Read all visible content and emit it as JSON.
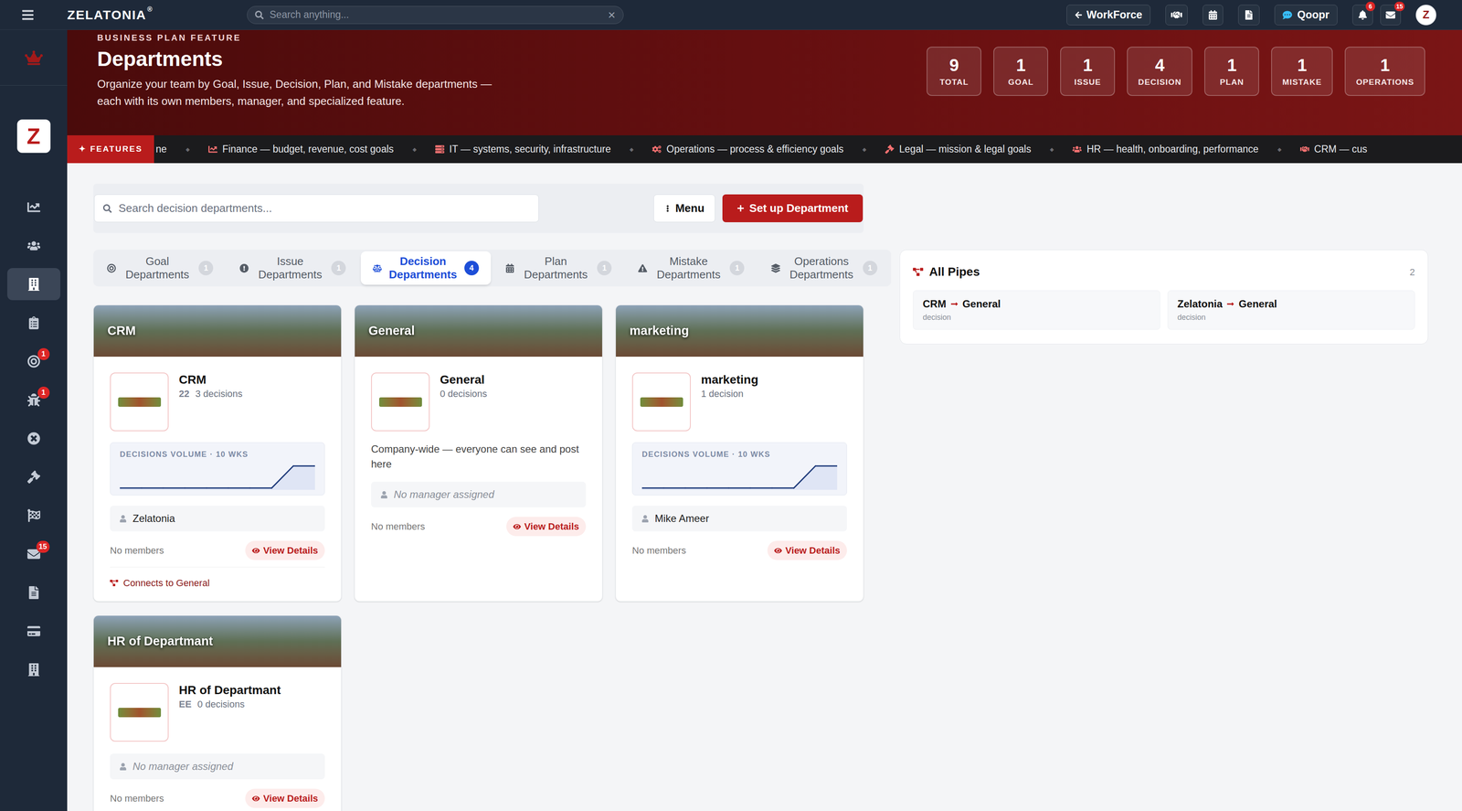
{
  "topbar": {
    "logo": "ZELATONIA",
    "logo_mark": "®",
    "search": {
      "placeholder": "Search anything...",
      "clear": "×"
    },
    "workforce": "WorkForce",
    "qoopr": "Qoopr",
    "notifications_badge": "6",
    "messages_badge": "15",
    "avatar": "Z"
  },
  "sidebar": {
    "brand": "Z",
    "items": [
      {
        "kind": "analytics",
        "selected": false,
        "badge": null
      },
      {
        "kind": "people",
        "selected": false,
        "badge": null
      },
      {
        "kind": "departments",
        "selected": true,
        "badge": null
      },
      {
        "kind": "tasks",
        "selected": false,
        "badge": null
      },
      {
        "kind": "goals",
        "selected": false,
        "badge": "1"
      },
      {
        "kind": "issues",
        "selected": false,
        "badge": "1"
      },
      {
        "kind": "mistakes",
        "selected": false,
        "badge": null
      },
      {
        "kind": "decisions",
        "selected": false,
        "badge": null
      },
      {
        "kind": "milestones",
        "selected": false,
        "badge": null
      },
      {
        "kind": "messages",
        "selected": false,
        "badge": "15"
      },
      {
        "kind": "documents",
        "selected": false,
        "badge": null
      },
      {
        "kind": "billing",
        "selected": false,
        "badge": null
      },
      {
        "kind": "company",
        "selected": false,
        "badge": null
      }
    ]
  },
  "header": {
    "eyebrow": "BUSINESS PLAN FEATURE",
    "title": "Departments",
    "description": "Organize your team by Goal, Issue, Decision, Plan, and Mistake departments — each with its own members, manager, and specialized feature.",
    "stats": [
      {
        "value": "9",
        "label": "TOTAL"
      },
      {
        "value": "1",
        "label": "GOAL"
      },
      {
        "value": "1",
        "label": "ISSUE"
      },
      {
        "value": "4",
        "label": "DECISION"
      },
      {
        "value": "1",
        "label": "PLAN"
      },
      {
        "value": "1",
        "label": "MISTAKE"
      },
      {
        "value": "1",
        "label": "OPERATIONS"
      }
    ]
  },
  "features": {
    "icon": "✦",
    "label": "FEATURES",
    "separator": "◆",
    "items": [
      {
        "kind": "none",
        "text": "ne"
      },
      {
        "kind": "finance",
        "text": "Finance — budget, revenue, cost goals"
      },
      {
        "kind": "it",
        "text": "IT — systems, security, infrastructure"
      },
      {
        "kind": "operations",
        "text": "Operations — process & efficiency goals"
      },
      {
        "kind": "legal",
        "text": "Legal — mission & legal goals"
      },
      {
        "kind": "hr",
        "text": "HR — health, onboarding, performance"
      },
      {
        "kind": "crm",
        "text": "CRM — cus"
      }
    ]
  },
  "toolbar": {
    "search_placeholder": "Search decision departments...",
    "menu": "Menu",
    "setup": "Set up Department"
  },
  "tabs": [
    {
      "kind": "goal",
      "label": "Goal Departments",
      "count": "1",
      "selected": false
    },
    {
      "kind": "issue",
      "label": "Issue Departments",
      "count": "1",
      "selected": false
    },
    {
      "kind": "decision",
      "label": "Decision Departments",
      "count": "4",
      "selected": true
    },
    {
      "kind": "plan",
      "label": "Plan Departments",
      "count": "1",
      "selected": false
    },
    {
      "kind": "mistake",
      "label": "Mistake Departments",
      "count": "1",
      "selected": false
    },
    {
      "kind": "operations",
      "label": "Operations Departments",
      "count": "1",
      "selected": false
    }
  ],
  "cards": [
    {
      "banner": "CRM",
      "name": "CRM",
      "code": "22",
      "count": "3 decisions",
      "description": null,
      "chart": {
        "title": "DECISIONS VOLUME · 10 WKS",
        "values": [
          0,
          0,
          0,
          0,
          0,
          0,
          0,
          0,
          3,
          3
        ]
      },
      "manager": {
        "name": "Zelatonia",
        "assigned": true
      },
      "members": "No members",
      "action": "View Details",
      "connection": "Connects to General"
    },
    {
      "banner": "General",
      "name": "General",
      "code": null,
      "count": "0 decisions",
      "description": "Company-wide — everyone can see and post here",
      "chart": null,
      "manager": {
        "name": "No manager assigned",
        "assigned": false
      },
      "members": "No members",
      "action": "View Details",
      "connection": null
    },
    {
      "banner": "marketing",
      "name": "marketing",
      "code": null,
      "count": "1 decision",
      "description": null,
      "chart": {
        "title": "DECISIONS VOLUME · 10 WKS",
        "values": [
          0,
          0,
          0,
          0,
          0,
          0,
          0,
          0,
          1,
          1
        ]
      },
      "manager": {
        "name": "Mike Ameer",
        "assigned": true
      },
      "members": "No members",
      "action": "View Details",
      "connection": null
    },
    {
      "banner": "HR of Departmant",
      "name": "HR of Departmant",
      "code": "EE",
      "count": "0 decisions",
      "description": null,
      "chart": null,
      "manager": {
        "name": "No manager assigned",
        "assigned": false
      },
      "members": "No members",
      "action": "View Details",
      "connection": null
    }
  ],
  "pipes": {
    "title": "All Pipes",
    "count": "2",
    "items": [
      {
        "from": "CRM",
        "to": "General",
        "type": "decision"
      },
      {
        "from": "Zelatonia",
        "to": "General",
        "type": "decision"
      }
    ]
  }
}
